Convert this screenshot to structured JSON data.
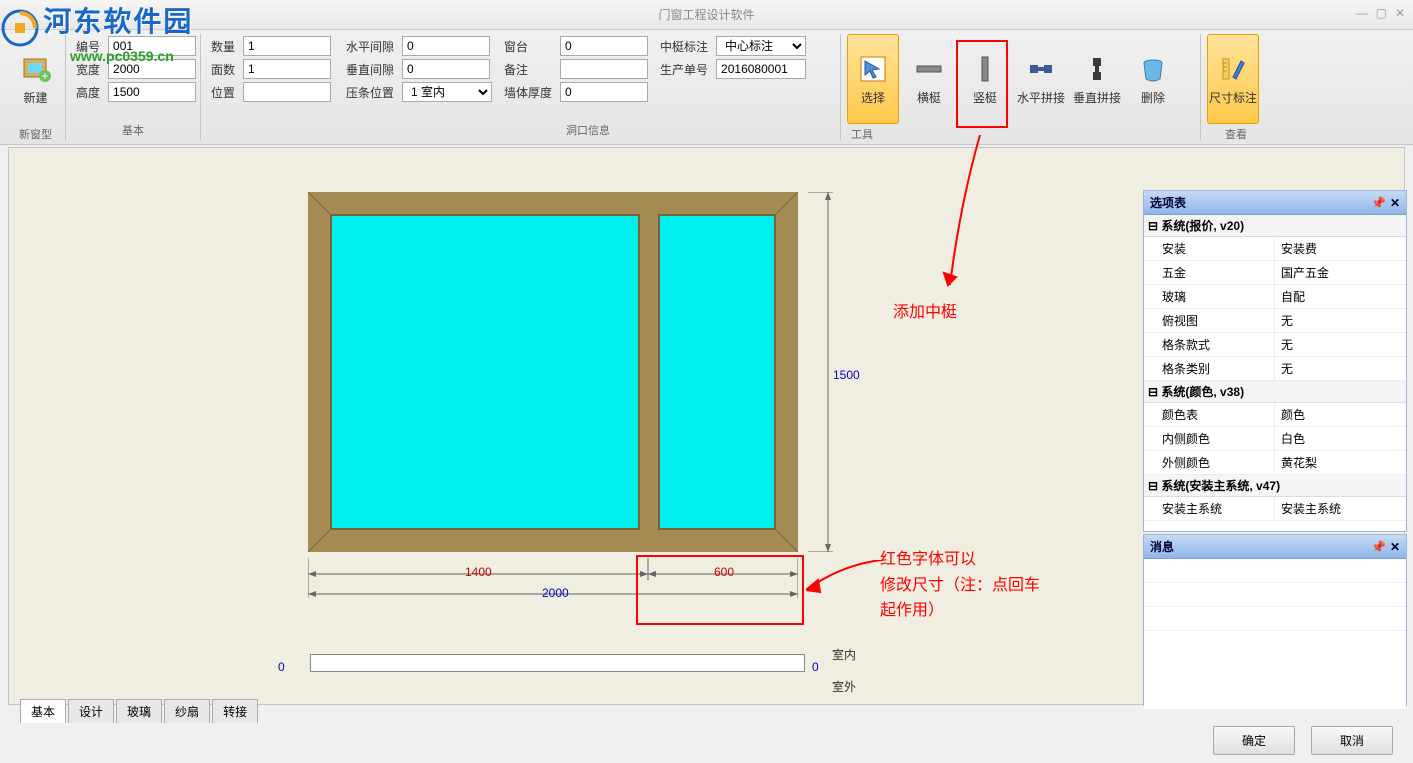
{
  "app": {
    "title": "门窗工程设计软件"
  },
  "watermark": {
    "main": "河东软件园",
    "sub": "www.pc0359.cn"
  },
  "ribbon": {
    "group_new": {
      "label": "新窗型",
      "btn": "新建"
    },
    "group_basic_label": "基本",
    "basic": {
      "id_label": "编号",
      "id_val": "001",
      "width_label": "宽度",
      "width_val": "2000",
      "height_label": "高度",
      "height_val": "1500",
      "qty_label": "数量",
      "qty_val": "1",
      "faces_label": "面数",
      "faces_val": "1",
      "pos_label": "位置",
      "pos_val": ""
    },
    "opening_label": "洞口信息",
    "opening": {
      "hgap_label": "水平间隙",
      "hgap_val": "0",
      "vgap_label": "垂直间隙",
      "vgap_val": "0",
      "strip_label": "压条位置",
      "strip_val": "1  室内",
      "sill_label": "窗台",
      "sill_val": "0",
      "note_label": "备注",
      "note_val": "",
      "wall_label": "墙体厚度",
      "wall_val": "0",
      "mullion_label": "中梃标注",
      "mullion_val": "中心标注",
      "order_label": "生产单号",
      "order_val": "2016080001"
    },
    "tools_label": "工具",
    "tools": {
      "select": "选择",
      "hmullion": "横梃",
      "vmullion": "竖梃",
      "hsplice": "水平拼接",
      "vsplice": "垂直拼接",
      "delete": "删除"
    },
    "view_label": "查看",
    "view": {
      "dimnote": "尺寸标注"
    }
  },
  "annotations": {
    "add_mullion": "添加中梃",
    "red_text_note": "红色字体可以\n修改尺寸（注：点回车\n起作用）"
  },
  "drawing": {
    "dim_height": "1500",
    "dim_w1": "1400",
    "dim_w2": "600",
    "dim_total": "2000",
    "indoor": "室内",
    "outdoor": "室外",
    "zero": "0"
  },
  "tabs": {
    "t1": "基本",
    "t2": "设计",
    "t3": "玻璃",
    "t4": "纱扇",
    "t5": "转接"
  },
  "options_panel": {
    "title": "选项表",
    "sec1": "系统(报价, v20)",
    "rows1": [
      {
        "k": "安装",
        "v": "安装费"
      },
      {
        "k": "五金",
        "v": "国产五金"
      },
      {
        "k": "玻璃",
        "v": "自配"
      },
      {
        "k": "俯视图",
        "v": "无"
      },
      {
        "k": "格条款式",
        "v": "无"
      },
      {
        "k": "格条类别",
        "v": "无"
      }
    ],
    "sec2": "系统(颜色, v38)",
    "rows2": [
      {
        "k": "颜色表",
        "v": "颜色"
      },
      {
        "k": "内侧颜色",
        "v": "白色"
      },
      {
        "k": "外侧颜色",
        "v": "黄花梨"
      }
    ],
    "sec3": "系统(安装主系统, v47)",
    "rows3": [
      {
        "k": "安装主系统",
        "v": "安装主系统"
      }
    ]
  },
  "msg_panel": {
    "title": "消息"
  },
  "footer": {
    "ok": "确定",
    "cancel": "取消"
  }
}
